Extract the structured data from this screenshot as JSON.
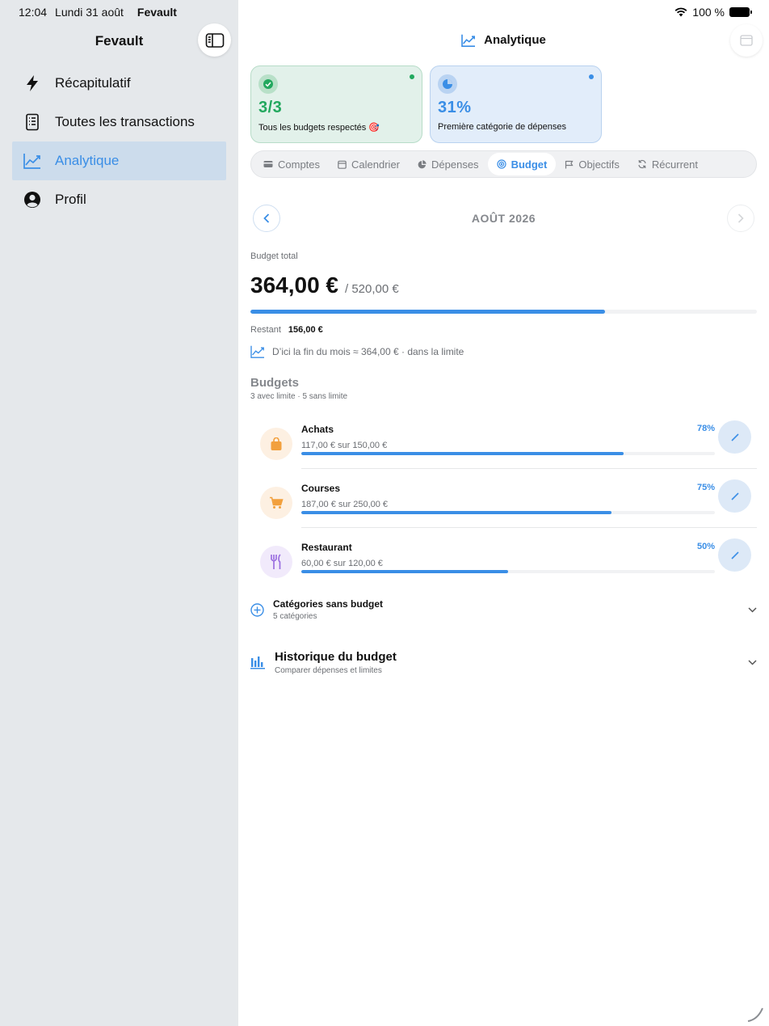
{
  "status": {
    "time": "12:04",
    "date": "Lundi 31 août",
    "app": "Fevault",
    "battery": "100 %"
  },
  "sidebar": {
    "title": "Fevault",
    "items": [
      {
        "label": "Récapitulatif",
        "icon": "bolt-icon"
      },
      {
        "label": "Toutes les transactions",
        "icon": "receipt-icon"
      },
      {
        "label": "Analytique",
        "icon": "chart-line-icon",
        "active": true
      },
      {
        "label": "Profil",
        "icon": "person-icon"
      }
    ]
  },
  "header": {
    "title": "Analytique"
  },
  "cards": [
    {
      "value": "3/3",
      "label": "Tous les budgets respectés 🎯"
    },
    {
      "value": "31%",
      "label": "Première catégorie de dépenses"
    }
  ],
  "tabs": [
    {
      "label": "Comptes",
      "icon": "card-icon"
    },
    {
      "label": "Calendrier",
      "icon": "calendar-icon"
    },
    {
      "label": "Dépenses",
      "icon": "pie-icon"
    },
    {
      "label": "Budget",
      "icon": "target-icon",
      "active": true
    },
    {
      "label": "Objectifs",
      "icon": "flag-icon"
    },
    {
      "label": "Récurrent",
      "icon": "repeat-icon"
    }
  ],
  "month": {
    "label": "AOÛT 2026"
  },
  "budget_total": {
    "label": "Budget total",
    "amount": "364,00 €",
    "limit": "/ 520,00 €",
    "progress": 0.7,
    "remaining_label": "Restant",
    "remaining_value": "156,00 €",
    "forecast": "D’ici la fin du mois ≈ 364,00 € · dans la limite"
  },
  "budgets": {
    "title": "Budgets",
    "subtitle": "3 avec limite · 5 sans limite",
    "items": [
      {
        "name": "Achats",
        "amount": "117,00 € sur 150,00 €",
        "percent": "78%",
        "progress": 0.78,
        "icon": "shopping-bag-icon",
        "color": "#f2a03d",
        "bg": "#fdf0e2"
      },
      {
        "name": "Courses",
        "amount": "187,00 € sur 250,00 €",
        "percent": "75%",
        "progress": 0.75,
        "icon": "cart-icon",
        "color": "#f2a03d",
        "bg": "#fdf0e2"
      },
      {
        "name": "Restaurant",
        "amount": "60,00 € sur 120,00 €",
        "percent": "50%",
        "progress": 0.5,
        "icon": "fork-knife-icon",
        "color": "#9b6fe0",
        "bg": "#f1eafb"
      }
    ]
  },
  "unbudgeted": {
    "title": "Catégories sans budget",
    "subtitle": "5 catégories"
  },
  "history": {
    "title": "Historique du budget",
    "subtitle": "Comparer dépenses et limites"
  },
  "colors": {
    "accent": "#3a8ee6",
    "success": "#22a85e",
    "sidebar_bg": "#e5e8eb",
    "active_nav_bg": "#ccdcec"
  }
}
